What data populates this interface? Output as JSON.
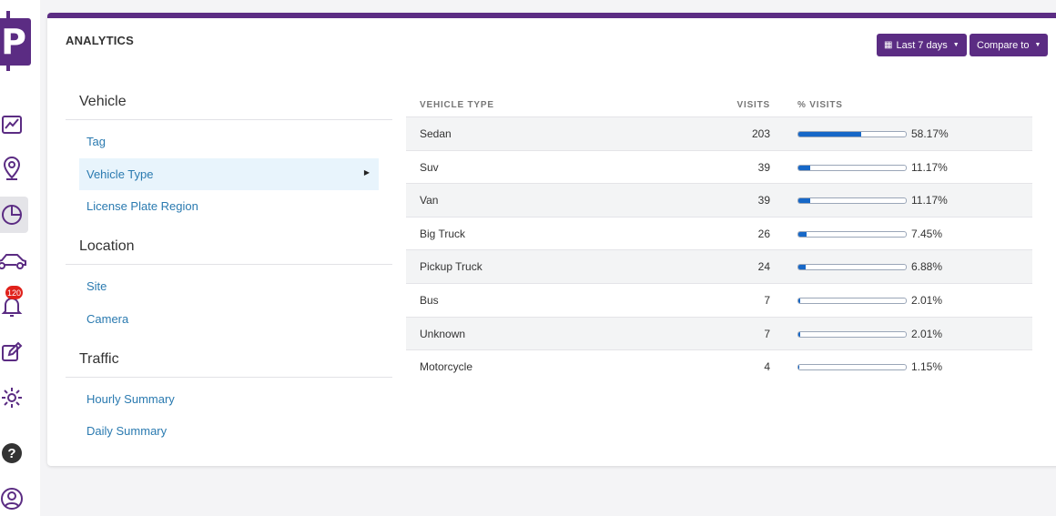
{
  "logo": {
    "letter": "P"
  },
  "rail": {
    "icons": [
      "line-chart-icon",
      "map-pin-icon",
      "pie-chart-icon",
      "car-icon",
      "bell-icon",
      "edit-icon",
      "gear-icon",
      "help-icon",
      "user-circle-icon"
    ],
    "notification_count": "120"
  },
  "header": {
    "title": "ANALYTICS",
    "date_range_label": "Last 7 days",
    "compare_label": "Compare to"
  },
  "nav": {
    "vehicle": {
      "heading": "Vehicle",
      "items": [
        "Tag",
        "Vehicle Type",
        "License Plate Region"
      ]
    },
    "location": {
      "heading": "Location",
      "items": [
        "Site",
        "Camera"
      ]
    },
    "traffic": {
      "heading": "Traffic",
      "items": [
        "Hourly Summary",
        "Daily Summary"
      ]
    },
    "active_item": "Vehicle Type"
  },
  "table": {
    "columns": [
      "VEHICLE TYPE",
      "VISITS",
      "% VISITS"
    ],
    "rows": [
      {
        "type": "Sedan",
        "visits": "203",
        "pct": "58.17%",
        "fraction": 0.5817
      },
      {
        "type": "Suv",
        "visits": "39",
        "pct": "11.17%",
        "fraction": 0.1117
      },
      {
        "type": "Van",
        "visits": "39",
        "pct": "11.17%",
        "fraction": 0.1117
      },
      {
        "type": "Big Truck",
        "visits": "26",
        "pct": "7.45%",
        "fraction": 0.0745
      },
      {
        "type": "Pickup Truck",
        "visits": "24",
        "pct": "6.88%",
        "fraction": 0.0688
      },
      {
        "type": "Bus",
        "visits": "7",
        "pct": "2.01%",
        "fraction": 0.0201
      },
      {
        "type": "Unknown",
        "visits": "7",
        "pct": "2.01%",
        "fraction": 0.0201
      },
      {
        "type": "Motorcycle",
        "visits": "4",
        "pct": "1.15%",
        "fraction": 0.0115
      }
    ]
  },
  "colors": {
    "brand": "#5b2c83",
    "link": "#2a7ab0",
    "bar": "#1667c7",
    "badge": "#e0211b"
  }
}
